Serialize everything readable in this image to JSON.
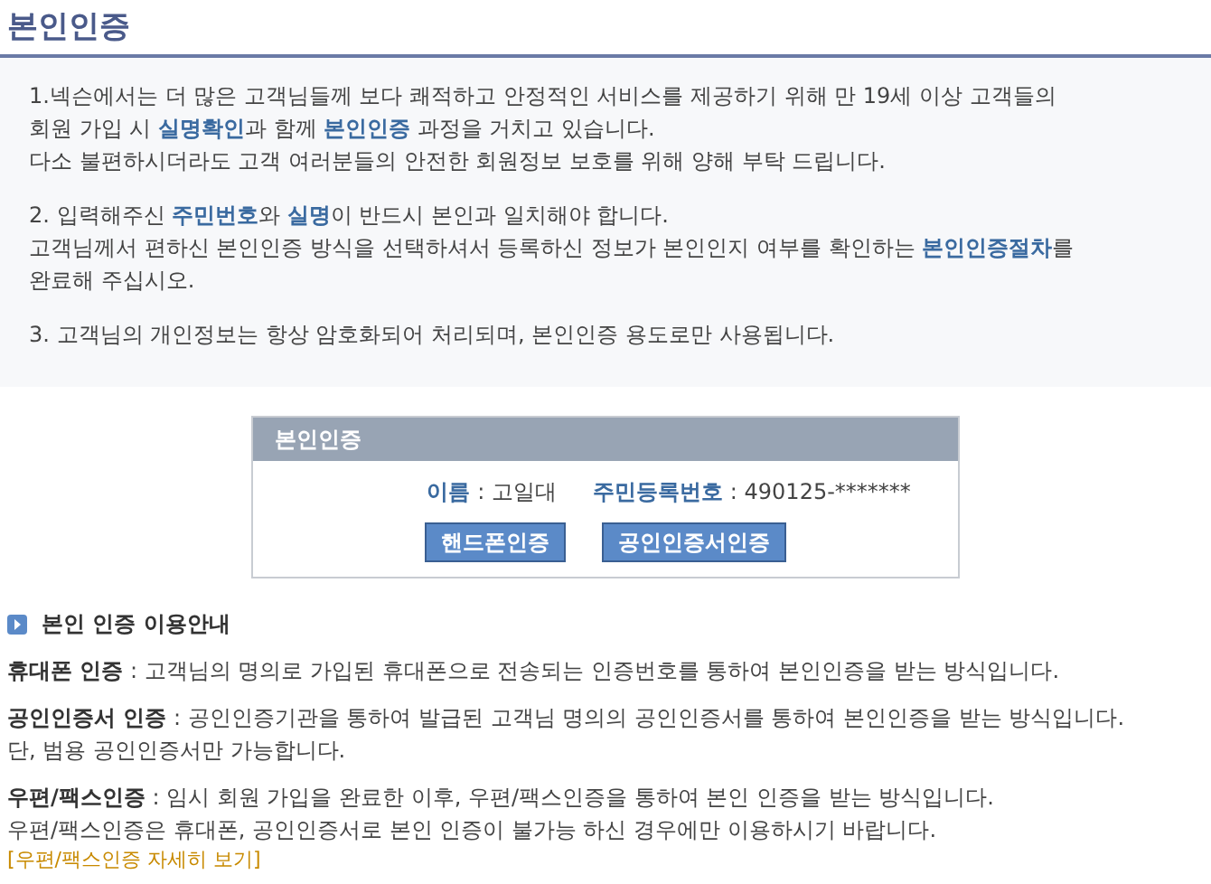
{
  "page_title": "본인인증",
  "notice": [
    [
      "1.넥슨에서는 더 많은 고객님들께 보다 쾌적하고 안정적인 서비스를 제공하기 위해 만 19세 이상 고객들의",
      "회원 가입 시 **실명확인**과 함께 **본인인증** 과정을 거치고 있습니다.",
      "다소 불편하시더라도 고객 여러분들의 안전한 회원정보 보호를 위해 양해 부탁 드립니다."
    ],
    [
      "2. 입력해주신 **주민번호**와 **실명**이 반드시 본인과 일치해야 합니다.",
      "고객님께서 편하신 본인인증 방식을 선택하셔서 등록하신 정보가 본인인지 여부를 확인하는 **본인인증절차**를",
      "완료해 주십시오."
    ],
    [
      "3. 고객님의 개인정보는 항상 암호화되어 처리되며, 본인인증 용도로만 사용됩니다."
    ]
  ],
  "panel": {
    "title": "본인인증",
    "name_label": "이름",
    "name_value": ": 고일대",
    "id_label": "주민등록번호",
    "id_value": ": 490125-*******",
    "buttons": [
      "핸드폰인증",
      "공인인증서인증"
    ]
  },
  "guide": {
    "title": "본인 인증 이용안내",
    "items": [
      [
        "**휴대폰 인증** : 고객님의 명의로 가입된 휴대폰으로 전송되는 인증번호를 통하여 본인인증을 받는 방식입니다."
      ],
      [
        "**공인인증서 인증** : 공인인증기관을 통하여 발급된 고객님 명의의 공인인증서를 통하여 본인인증을 받는 방식입니다.",
        "단, 범용 공인인증서만 가능합니다."
      ],
      [
        "**우편/팩스인증** : 임시 회원 가입을 완료한 이후, 우편/팩스인증을 통하여 본인 인증을 받는 방식입니다.",
        "우편/팩스인증은 휴대폰, 공인인증서로 본인 인증이 불가능 하신 경우에만 이용하시기 바랍니다."
      ]
    ],
    "link": "[우편/팩스인증 자세히 보기]"
  }
}
